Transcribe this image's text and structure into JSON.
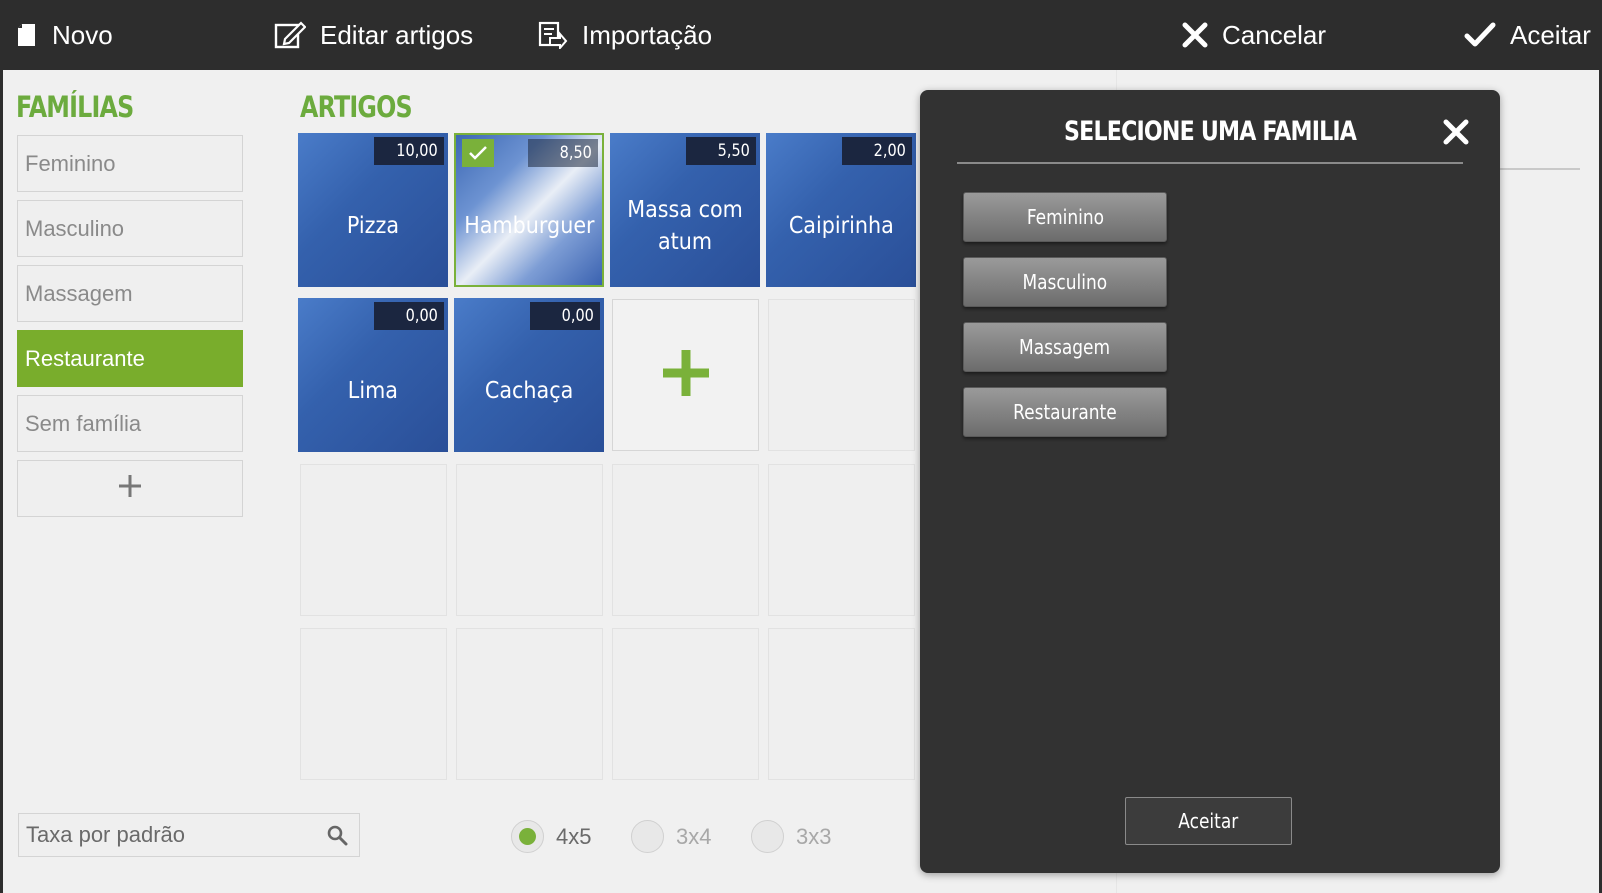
{
  "toolbar": {
    "new_label": "Novo",
    "edit_articles_label": "Editar artigos",
    "import_label": "Importação",
    "cancel_label": "Cancelar",
    "accept_label": "Aceitar"
  },
  "families": {
    "title": "FAMÍLIAS",
    "items": [
      {
        "label": "Feminino",
        "active": false
      },
      {
        "label": "Masculino",
        "active": false
      },
      {
        "label": "Massagem",
        "active": false
      },
      {
        "label": "Restaurante",
        "active": true
      },
      {
        "label": "Sem família",
        "active": false
      }
    ],
    "add_icon": "plus-icon"
  },
  "articles": {
    "title": "ARTIGOS",
    "items": [
      {
        "name": "Pizza",
        "price": "10,00",
        "selected": false
      },
      {
        "name": "Hamburguer",
        "price": "8,50",
        "selected": true
      },
      {
        "name": "Massa com atum",
        "price": "5,50",
        "selected": false
      },
      {
        "name": "Caipirinha",
        "price": "2,00",
        "selected": false
      },
      {
        "name": "Lima",
        "price": "0,00",
        "selected": false
      },
      {
        "name": "Cachaça",
        "price": "0,00",
        "selected": false
      }
    ],
    "add_icon": "plus-icon"
  },
  "search": {
    "value": "Taxa por padrão"
  },
  "grid_size": {
    "options": [
      "4x5",
      "3x4",
      "3x3"
    ],
    "selected": "4x5"
  },
  "modal": {
    "title": "SELECIONE UMA FAMILIA",
    "options": [
      "Feminino",
      "Masculino",
      "Massagem",
      "Restaurante"
    ],
    "accept_label": "Aceitar"
  },
  "colors": {
    "accent_green": "#79ad2c",
    "toolbar_bg": "#2d2d2d",
    "tile_blue": "#3461ad",
    "modal_bg": "#323232"
  }
}
